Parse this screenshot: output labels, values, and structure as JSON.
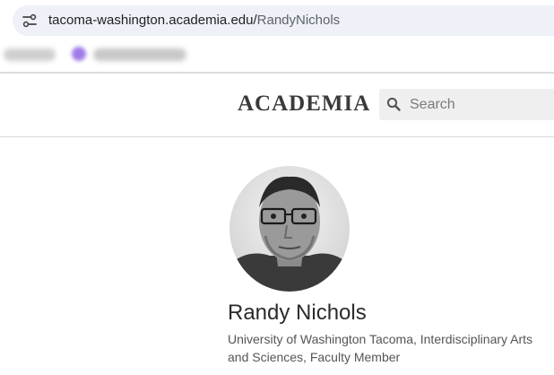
{
  "browser": {
    "url_host": "tacoma-washington.academia.edu/",
    "url_path": "RandyNichols",
    "site_info_icon": "tune-icon"
  },
  "header": {
    "logo_text": "ACADEMIA",
    "search_placeholder": "Search",
    "search_icon": "magnifier-icon"
  },
  "profile": {
    "name": "Randy Nichols",
    "affiliation": "University of Washington Tacoma, Interdisciplinary Arts and Sciences, Faculty Member",
    "avatar_icon": "profile-photo"
  },
  "colors": {
    "omnibox_bg": "#eef1f8",
    "search_bg": "#efefef",
    "logo": "#3a3a3a"
  }
}
